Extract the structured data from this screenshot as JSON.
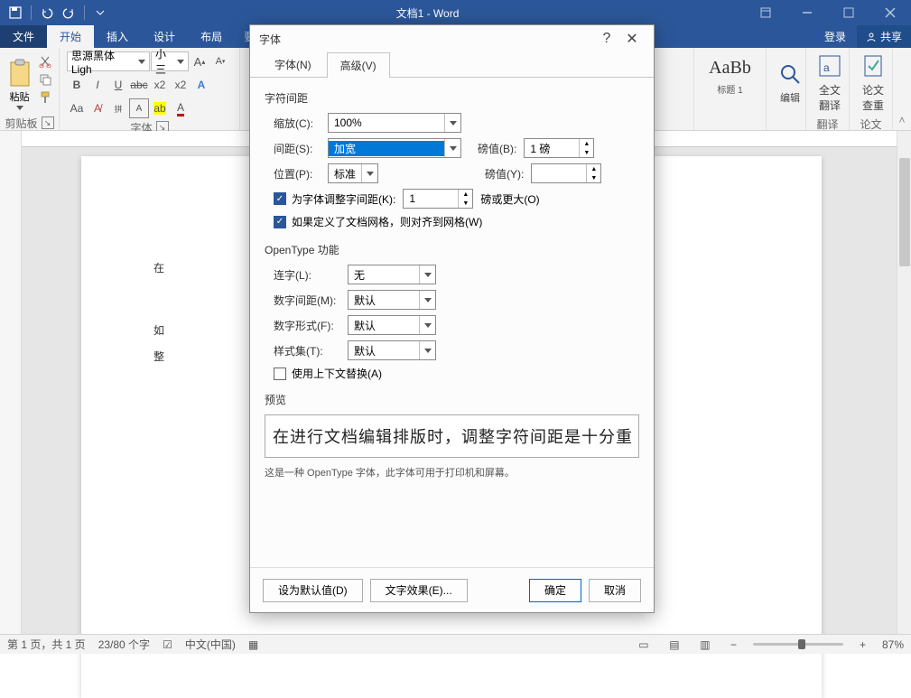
{
  "titlebar": {
    "title": "文档1 - Word"
  },
  "menubar": {
    "items": [
      "文件",
      "开始",
      "插入",
      "设计",
      "布局"
    ],
    "active": 1,
    "tell_me": "要做什么...",
    "login": "登录",
    "share": "共享"
  },
  "ribbon": {
    "clipboard": {
      "paste": "粘贴",
      "label": "剪贴板"
    },
    "font": {
      "name": "思源黑体 Ligh",
      "size": "小三",
      "label": "字体"
    },
    "styles": {
      "preview": "AaBb",
      "heading1": "标题 1"
    },
    "editing": {
      "label": "编辑"
    },
    "translate": {
      "l1": "全文",
      "l2": "翻译",
      "grp": "翻译"
    },
    "review": {
      "l1": "论文",
      "l2": "查重",
      "grp": "论文"
    }
  },
  "document": {
    "line1": "在",
    "line2": "如",
    "line3": "整"
  },
  "dialog": {
    "title": "字体",
    "tabs": {
      "font": "字体(N)",
      "advanced": "高级(V)"
    },
    "spacing_section": "字符间距",
    "scale_label": "缩放(C):",
    "scale_value": "100%",
    "spacing_label": "间距(S):",
    "spacing_value": "加宽",
    "spacing_pt_label": "磅值(B):",
    "spacing_pt_value": "1 磅",
    "position_label": "位置(P):",
    "position_value": "标准",
    "position_pt_label": "磅值(Y):",
    "position_pt_value": "",
    "kerning_check": "为字体调整字间距(K):",
    "kerning_value": "1",
    "kerning_suffix": "磅或更大(O)",
    "snap_check": "如果定义了文档网格，则对齐到网格(W)",
    "ot_section": "OpenType 功能",
    "ligatures_label": "连字(L):",
    "ligatures_value": "无",
    "numspacing_label": "数字间距(M):",
    "numspacing_value": "默认",
    "numform_label": "数字形式(F):",
    "numform_value": "默认",
    "styleset_label": "样式集(T):",
    "styleset_value": "默认",
    "context_check": "使用上下文替换(A)",
    "preview_label": "预览",
    "preview_text": "在进行文档编辑排版时，调整字符间距是十分重",
    "preview_note": "这是一种 OpenType 字体，此字体可用于打印机和屏幕。",
    "set_default": "设为默认值(D)",
    "text_effects": "文字效果(E)...",
    "ok": "确定",
    "cancel": "取消"
  },
  "statusbar": {
    "page": "第 1 页，共 1 页",
    "words": "23/80 个字",
    "proof": "中文(中国)",
    "zoom": "87%"
  }
}
